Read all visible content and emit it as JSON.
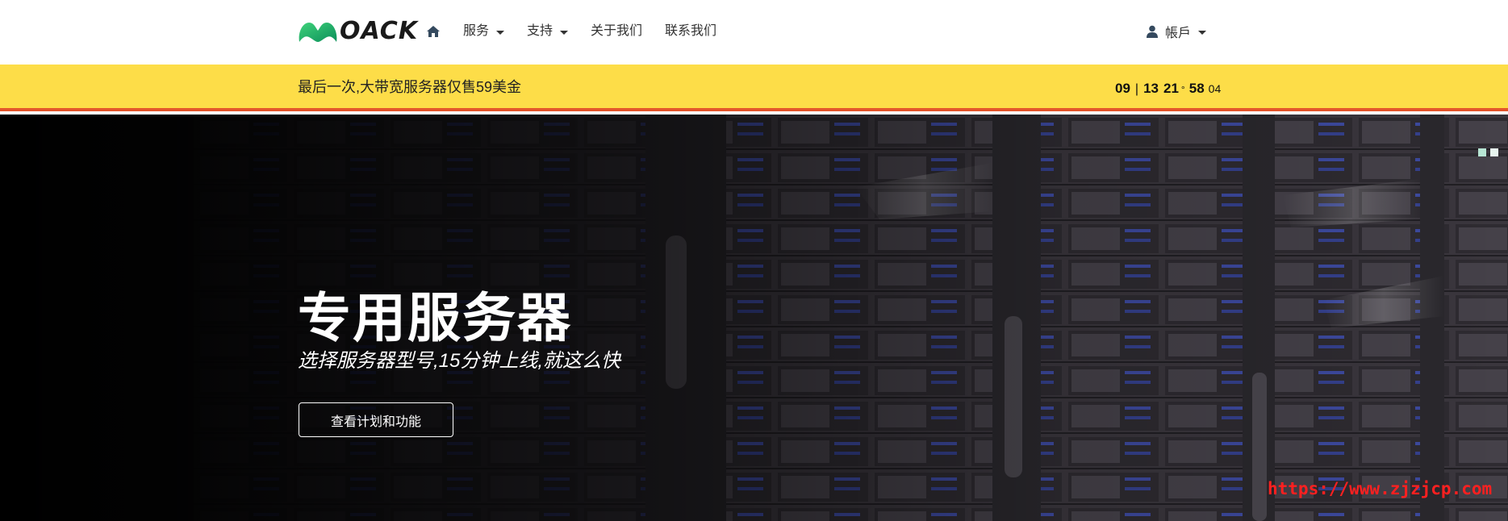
{
  "header": {
    "logo_text": "OACK",
    "nav": [
      {
        "label": "服务",
        "has_dropdown": true
      },
      {
        "label": "支持",
        "has_dropdown": true
      },
      {
        "label": "关于我们",
        "has_dropdown": false
      },
      {
        "label": "联系我们",
        "has_dropdown": false
      }
    ],
    "home_icon": "home-icon",
    "account_label": "帳戶",
    "account_icon": "user-icon"
  },
  "promo": {
    "text": "最后一次,大带宽服务器仅售59美金",
    "countdown": {
      "days": "09",
      "separator": "|",
      "hours": "13",
      "minutes": "21",
      "degree": "°",
      "seconds_big": "58",
      "seconds_small": "04"
    }
  },
  "hero": {
    "title": "专用服务器",
    "subtitle": "选择服务器型号,15分钟上线,就这么快",
    "button_label": "查看计划和功能"
  },
  "watermark": "https://www.zjzjcp.com",
  "colors": {
    "promo_bg": "#fddd48",
    "promo_border": "#e3542a",
    "logo_green": "#1dbf73",
    "watermark": "#ff2020",
    "slider_dot": "#b8e6d4"
  }
}
